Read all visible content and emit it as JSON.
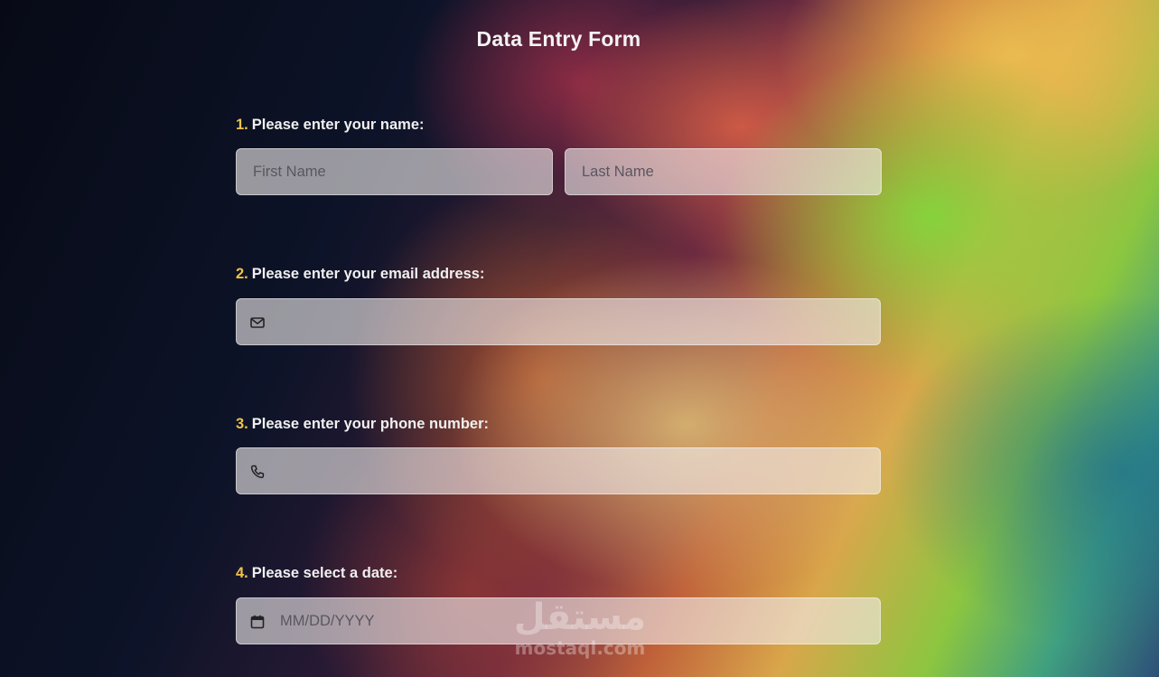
{
  "form": {
    "title": "Data Entry Form",
    "questions": [
      {
        "number": "1.",
        "label": "Please enter your name:",
        "fields": [
          {
            "placeholder": "First Name",
            "value": ""
          },
          {
            "placeholder": "Last Name",
            "value": ""
          }
        ]
      },
      {
        "number": "2.",
        "label": "Please enter your email address:",
        "icon": "envelope-icon",
        "field": {
          "placeholder": "",
          "value": ""
        }
      },
      {
        "number": "3.",
        "label": "Please enter your phone number:",
        "icon": "phone-icon",
        "field": {
          "placeholder": "",
          "value": ""
        }
      },
      {
        "number": "4.",
        "label": "Please select a date:",
        "icon": "calendar-icon",
        "field": {
          "placeholder": "MM/DD/YYYY",
          "value": ""
        }
      }
    ]
  },
  "watermark": {
    "arabic": "مستقل",
    "latin": "mostaql.com"
  },
  "colors": {
    "number_accent": "#f1c24a",
    "label_text": "#f0f0f0",
    "field_bg": "rgba(240,235,235,0.62)"
  }
}
